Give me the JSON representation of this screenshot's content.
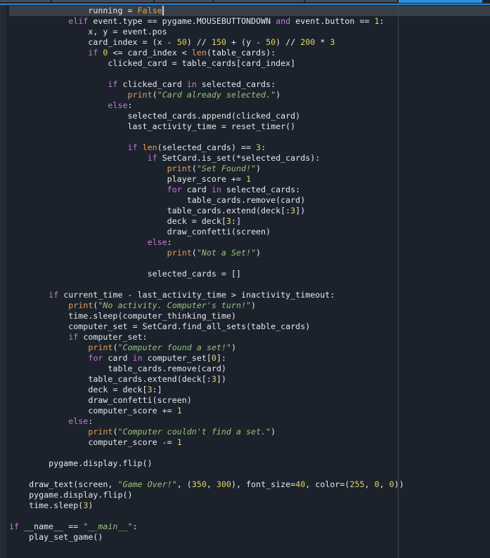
{
  "editor": {
    "language": "python",
    "cursor_line": 0,
    "tabs": [
      {
        "label": "",
        "active": false
      },
      {
        "label": "",
        "active": false
      },
      {
        "label": "",
        "active": false
      },
      {
        "label": "",
        "active": false
      },
      {
        "label": "",
        "active": false
      },
      {
        "label": "",
        "active": true
      }
    ],
    "colors": {
      "background": "#1b222b",
      "keyword": "#c678dd",
      "builtin": "#e5a05a",
      "number": "#e6d35f",
      "string": "#98c379",
      "text": "#e6e9ee",
      "accent": "#2f8fdc"
    },
    "lines": [
      {
        "indent": 16,
        "tokens": [
          [
            "txt",
            "running = "
          ],
          [
            "const",
            "False"
          ]
        ],
        "cursor": true
      },
      {
        "indent": 12,
        "tokens": [
          [
            "kw",
            "elif"
          ],
          [
            "txt",
            " event.type == pygame.MOUSEBUTTONDOWN "
          ],
          [
            "kw",
            "and"
          ],
          [
            "txt",
            " event.button == "
          ],
          [
            "num",
            "1"
          ],
          [
            "txt",
            ":"
          ]
        ]
      },
      {
        "indent": 16,
        "tokens": [
          [
            "txt",
            "x, y = event.pos"
          ]
        ]
      },
      {
        "indent": 16,
        "tokens": [
          [
            "txt",
            "card_index = (x - "
          ],
          [
            "num",
            "50"
          ],
          [
            "txt",
            ") // "
          ],
          [
            "num",
            "150"
          ],
          [
            "txt",
            " + (y - "
          ],
          [
            "num",
            "50"
          ],
          [
            "txt",
            ") // "
          ],
          [
            "num",
            "200"
          ],
          [
            "txt",
            " * "
          ],
          [
            "num",
            "3"
          ]
        ]
      },
      {
        "indent": 16,
        "tokens": [
          [
            "kw",
            "if"
          ],
          [
            "txt",
            " "
          ],
          [
            "num",
            "0"
          ],
          [
            "txt",
            " <= card_index < "
          ],
          [
            "bi",
            "len"
          ],
          [
            "txt",
            "(table_cards):"
          ]
        ]
      },
      {
        "indent": 20,
        "tokens": [
          [
            "txt",
            "clicked_card = table_cards[card_index]"
          ]
        ]
      },
      {
        "indent": 0,
        "tokens": []
      },
      {
        "indent": 20,
        "tokens": [
          [
            "kw",
            "if"
          ],
          [
            "txt",
            " clicked_card "
          ],
          [
            "kw",
            "in"
          ],
          [
            "txt",
            " selected_cards:"
          ]
        ]
      },
      {
        "indent": 24,
        "tokens": [
          [
            "bi",
            "print"
          ],
          [
            "txt",
            "("
          ],
          [
            "str",
            "\"Card already selected.\""
          ],
          [
            "txt",
            ")"
          ]
        ]
      },
      {
        "indent": 20,
        "tokens": [
          [
            "kw",
            "else"
          ],
          [
            "txt",
            ":"
          ]
        ]
      },
      {
        "indent": 24,
        "tokens": [
          [
            "txt",
            "selected_cards.append(clicked_card)"
          ]
        ]
      },
      {
        "indent": 24,
        "tokens": [
          [
            "txt",
            "last_activity_time = reset_timer()"
          ]
        ]
      },
      {
        "indent": 0,
        "tokens": []
      },
      {
        "indent": 24,
        "tokens": [
          [
            "kw",
            "if"
          ],
          [
            "txt",
            " "
          ],
          [
            "bi",
            "len"
          ],
          [
            "txt",
            "(selected_cards) == "
          ],
          [
            "num",
            "3"
          ],
          [
            "txt",
            ":"
          ]
        ]
      },
      {
        "indent": 28,
        "tokens": [
          [
            "kw",
            "if"
          ],
          [
            "txt",
            " SetCard.is_set(*selected_cards):"
          ]
        ]
      },
      {
        "indent": 32,
        "tokens": [
          [
            "bi",
            "print"
          ],
          [
            "txt",
            "("
          ],
          [
            "str",
            "\"Set Found!\""
          ],
          [
            "txt",
            ")"
          ]
        ]
      },
      {
        "indent": 32,
        "tokens": [
          [
            "txt",
            "player_score += "
          ],
          [
            "num",
            "1"
          ]
        ]
      },
      {
        "indent": 32,
        "tokens": [
          [
            "kw",
            "for"
          ],
          [
            "txt",
            " card "
          ],
          [
            "kw",
            "in"
          ],
          [
            "txt",
            " selected_cards:"
          ]
        ]
      },
      {
        "indent": 36,
        "tokens": [
          [
            "txt",
            "table_cards.remove(card)"
          ]
        ]
      },
      {
        "indent": 32,
        "tokens": [
          [
            "txt",
            "table_cards.extend(deck[:"
          ],
          [
            "num",
            "3"
          ],
          [
            "txt",
            "])"
          ]
        ]
      },
      {
        "indent": 32,
        "tokens": [
          [
            "txt",
            "deck = deck["
          ],
          [
            "num",
            "3"
          ],
          [
            "txt",
            ":]"
          ]
        ]
      },
      {
        "indent": 32,
        "tokens": [
          [
            "txt",
            "draw_confetti(screen)"
          ]
        ]
      },
      {
        "indent": 28,
        "tokens": [
          [
            "kw",
            "else"
          ],
          [
            "txt",
            ":"
          ]
        ]
      },
      {
        "indent": 32,
        "tokens": [
          [
            "bi",
            "print"
          ],
          [
            "txt",
            "("
          ],
          [
            "str",
            "\"Not a Set!\""
          ],
          [
            "txt",
            ")"
          ]
        ]
      },
      {
        "indent": 0,
        "tokens": []
      },
      {
        "indent": 28,
        "tokens": [
          [
            "txt",
            "selected_cards = []"
          ]
        ]
      },
      {
        "indent": 0,
        "tokens": []
      },
      {
        "indent": 8,
        "tokens": [
          [
            "kw",
            "if"
          ],
          [
            "txt",
            " current_time - last_activity_time > inactivity_timeout:"
          ]
        ]
      },
      {
        "indent": 12,
        "tokens": [
          [
            "bi",
            "print"
          ],
          [
            "txt",
            "("
          ],
          [
            "str",
            "\"No activity. Computer's turn!\""
          ],
          [
            "txt",
            ")"
          ]
        ]
      },
      {
        "indent": 12,
        "tokens": [
          [
            "txt",
            "time.sleep(computer_thinking_time)"
          ]
        ]
      },
      {
        "indent": 12,
        "tokens": [
          [
            "txt",
            "computer_set = SetCard.find_all_sets(table_cards)"
          ]
        ]
      },
      {
        "indent": 12,
        "tokens": [
          [
            "kw",
            "if"
          ],
          [
            "txt",
            " computer_set:"
          ]
        ]
      },
      {
        "indent": 16,
        "tokens": [
          [
            "bi",
            "print"
          ],
          [
            "txt",
            "("
          ],
          [
            "str",
            "\"Computer found a set!\""
          ],
          [
            "txt",
            ")"
          ]
        ]
      },
      {
        "indent": 16,
        "tokens": [
          [
            "kw",
            "for"
          ],
          [
            "txt",
            " card "
          ],
          [
            "kw",
            "in"
          ],
          [
            "txt",
            " computer_set["
          ],
          [
            "num",
            "0"
          ],
          [
            "txt",
            "]:"
          ]
        ]
      },
      {
        "indent": 20,
        "tokens": [
          [
            "txt",
            "table_cards.remove(card)"
          ]
        ]
      },
      {
        "indent": 16,
        "tokens": [
          [
            "txt",
            "table_cards.extend(deck[:"
          ],
          [
            "num",
            "3"
          ],
          [
            "txt",
            "])"
          ]
        ]
      },
      {
        "indent": 16,
        "tokens": [
          [
            "txt",
            "deck = deck["
          ],
          [
            "num",
            "3"
          ],
          [
            "txt",
            ":]"
          ]
        ]
      },
      {
        "indent": 16,
        "tokens": [
          [
            "txt",
            "draw_confetti(screen)"
          ]
        ]
      },
      {
        "indent": 16,
        "tokens": [
          [
            "txt",
            "computer_score += "
          ],
          [
            "num",
            "1"
          ]
        ]
      },
      {
        "indent": 12,
        "tokens": [
          [
            "kw",
            "else"
          ],
          [
            "txt",
            ":"
          ]
        ]
      },
      {
        "indent": 16,
        "tokens": [
          [
            "bi",
            "print"
          ],
          [
            "txt",
            "("
          ],
          [
            "str",
            "\"Computer couldn't find a set.\""
          ],
          [
            "txt",
            ")"
          ]
        ]
      },
      {
        "indent": 16,
        "tokens": [
          [
            "txt",
            "computer_score -= "
          ],
          [
            "num",
            "1"
          ]
        ]
      },
      {
        "indent": 0,
        "tokens": []
      },
      {
        "indent": 8,
        "tokens": [
          [
            "txt",
            "pygame.display.flip()"
          ]
        ]
      },
      {
        "indent": 0,
        "tokens": []
      },
      {
        "indent": 4,
        "tokens": [
          [
            "txt",
            "draw_text(screen, "
          ],
          [
            "str",
            "\"Game Over!\""
          ],
          [
            "txt",
            ", ("
          ],
          [
            "num",
            "350"
          ],
          [
            "txt",
            ", "
          ],
          [
            "num",
            "300"
          ],
          [
            "txt",
            "), font_size="
          ],
          [
            "num",
            "40"
          ],
          [
            "txt",
            ", color=("
          ],
          [
            "num",
            "255"
          ],
          [
            "txt",
            ", "
          ],
          [
            "num",
            "0"
          ],
          [
            "txt",
            ", "
          ],
          [
            "num",
            "0"
          ],
          [
            "txt",
            "))"
          ]
        ]
      },
      {
        "indent": 4,
        "tokens": [
          [
            "txt",
            "pygame.display.flip()"
          ]
        ]
      },
      {
        "indent": 4,
        "tokens": [
          [
            "txt",
            "time.sleep("
          ],
          [
            "num",
            "3"
          ],
          [
            "txt",
            ")"
          ]
        ]
      },
      {
        "indent": 0,
        "tokens": []
      },
      {
        "indent": 0,
        "tokens": [
          [
            "kw",
            "if"
          ],
          [
            "txt",
            " __name__ == "
          ],
          [
            "str",
            "\"__main__\""
          ],
          [
            "txt",
            ":"
          ]
        ]
      },
      {
        "indent": 4,
        "tokens": [
          [
            "txt",
            "play_set_game()"
          ]
        ]
      }
    ]
  }
}
